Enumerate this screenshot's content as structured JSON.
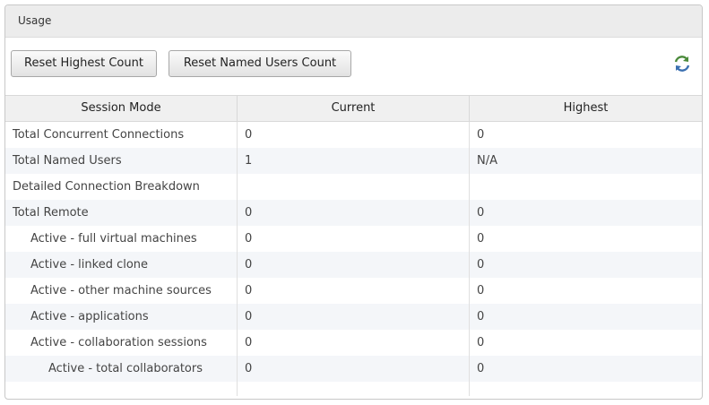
{
  "panel": {
    "title": "Usage"
  },
  "toolbar": {
    "reset_highest_label": "Reset Highest Count",
    "reset_named_label": "Reset Named Users Count",
    "refresh_icon": "refresh-icon"
  },
  "table": {
    "headers": [
      "Session Mode",
      "Current",
      "Highest"
    ],
    "rows": [
      {
        "mode": "Total Concurrent Connections",
        "current": "0",
        "highest": "0",
        "indent": 0
      },
      {
        "mode": "Total Named Users",
        "current": "1",
        "highest": "N/A",
        "indent": 0
      },
      {
        "mode": "Detailed Connection Breakdown",
        "current": "",
        "highest": "",
        "indent": 0
      },
      {
        "mode": "Total Remote",
        "current": "0",
        "highest": "0",
        "indent": 0
      },
      {
        "mode": "Active - full virtual machines",
        "current": "0",
        "highest": "0",
        "indent": 1
      },
      {
        "mode": "Active - linked clone",
        "current": "0",
        "highest": "0",
        "indent": 1
      },
      {
        "mode": "Active - other machine sources",
        "current": "0",
        "highest": "0",
        "indent": 1
      },
      {
        "mode": "Active - applications",
        "current": "0",
        "highest": "0",
        "indent": 1
      },
      {
        "mode": "Active - collaboration sessions",
        "current": "0",
        "highest": "0",
        "indent": 1
      },
      {
        "mode": "Active - total collaborators",
        "current": "0",
        "highest": "0",
        "indent": 2
      }
    ]
  }
}
